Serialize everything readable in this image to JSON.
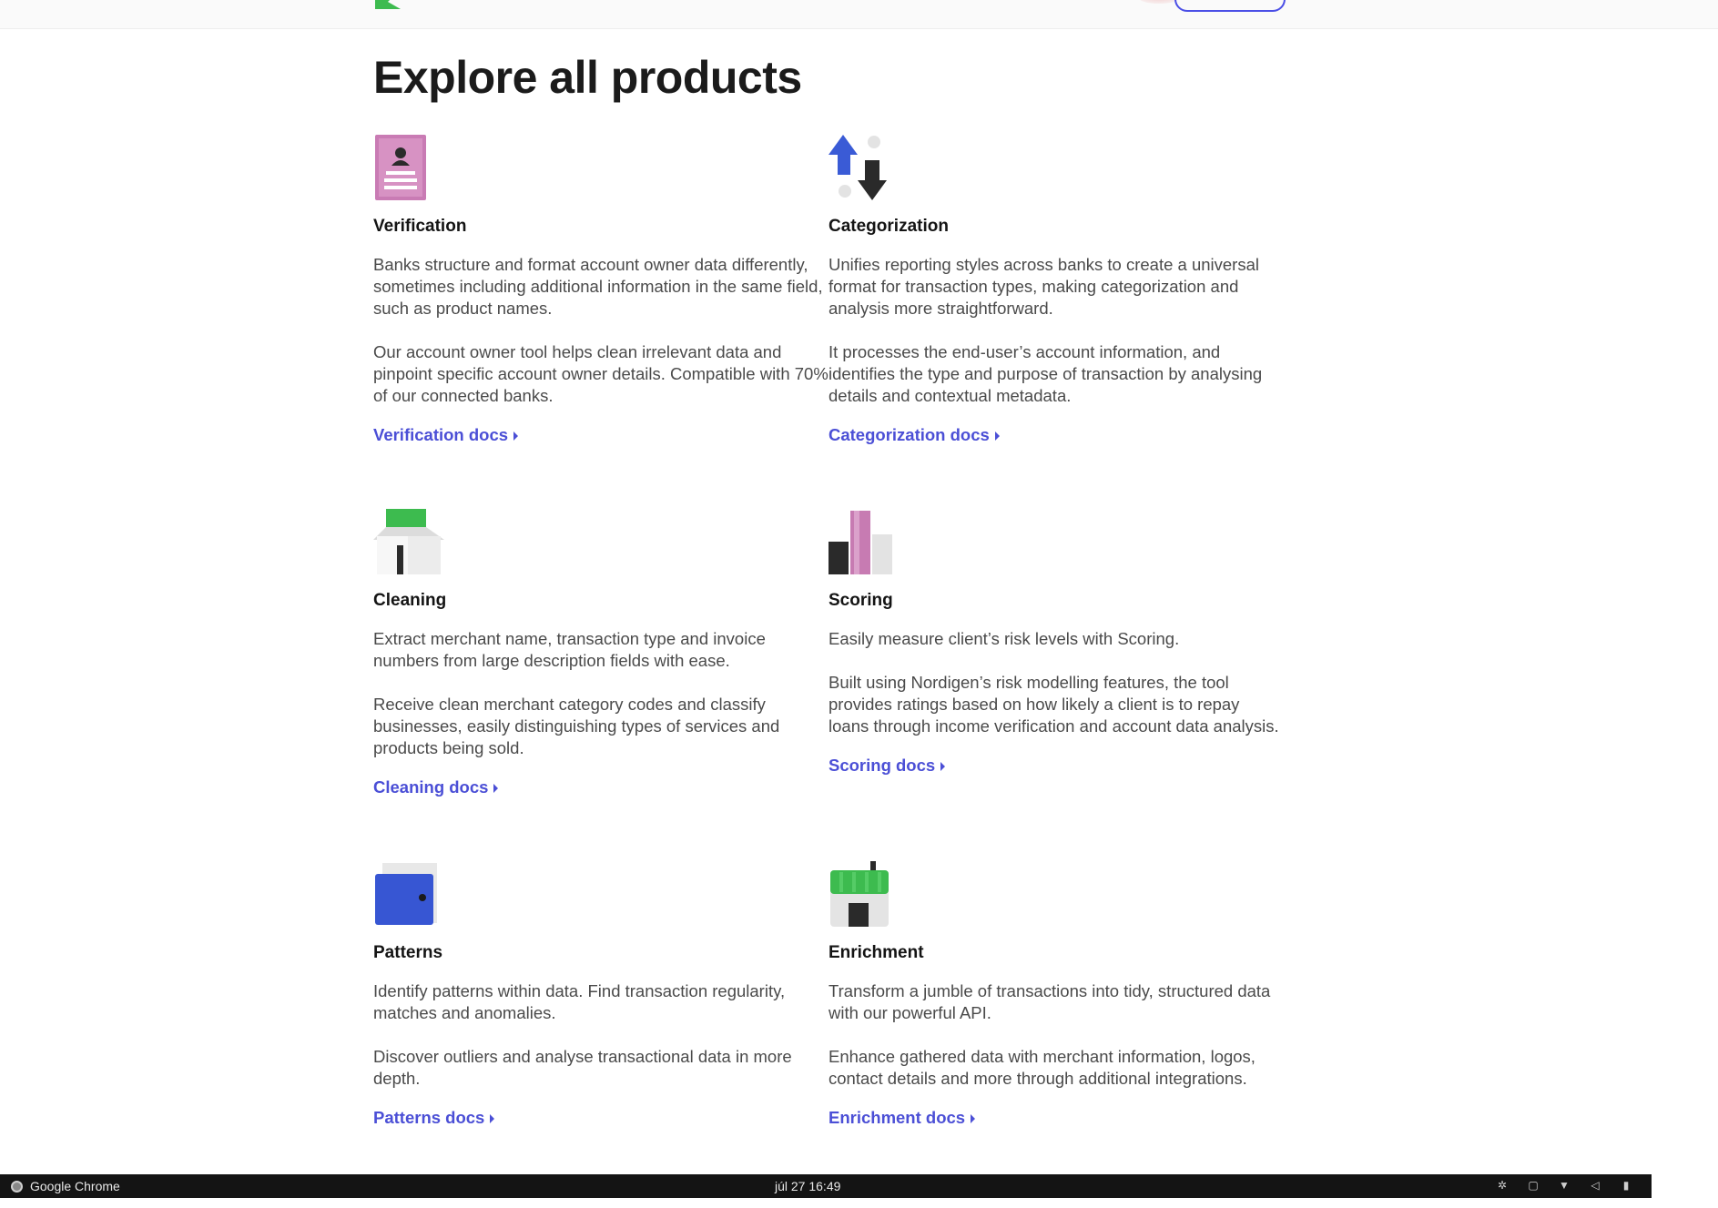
{
  "page": {
    "title": "Explore all products"
  },
  "products": [
    {
      "id": "verification",
      "icon": "id-card-icon",
      "title": "Verification",
      "paragraphs": [
        "Banks structure and format account owner data differently, sometimes including additional information in the same field, such as product names.",
        "Our account owner tool helps clean irrelevant data and pinpoint specific account owner details. Compatible with 70% of our connected banks."
      ],
      "link": "Verification docs"
    },
    {
      "id": "categorization",
      "icon": "up-down-arrows-icon",
      "title": "Categorization",
      "paragraphs": [
        "Unifies reporting styles across banks to create a universal format for transaction types, making categorization and analysis more straightforward.",
        "It processes the end-user’s account information, and identifies the type and purpose of transaction by analysing details and contextual metadata."
      ],
      "link": "Categorization docs"
    },
    {
      "id": "cleaning",
      "icon": "open-box-icon",
      "title": "Cleaning",
      "paragraphs": [
        "Extract merchant name, transaction type and invoice numbers from large description fields with ease.",
        "Receive clean merchant category codes and classify businesses, easily distinguishing types of services and products being sold."
      ],
      "link": "Cleaning docs"
    },
    {
      "id": "scoring",
      "icon": "bar-columns-icon",
      "title": "Scoring",
      "paragraphs": [
        "Easily measure client’s risk levels with Scoring.",
        "Built using Nordigen’s risk modelling features, the tool provides ratings based on how likely a client is to repay loans through income verification and account data analysis."
      ],
      "link": "Scoring docs"
    },
    {
      "id": "patterns",
      "icon": "wallet-icon",
      "title": "Patterns",
      "paragraphs": [
        "Identify patterns within data. Find transaction regularity, matches and anomalies.",
        "Discover outliers and analyse transactional data in more depth."
      ],
      "link": "Patterns docs"
    },
    {
      "id": "enrichment",
      "icon": "storefront-icon",
      "title": "Enrichment",
      "paragraphs": [
        "Transform a jumble of transactions into tidy, structured data with our powerful API.",
        "Enhance gathered data with merchant information, logos, contact details and more through additional integrations."
      ],
      "link": "Enrichment docs"
    }
  ],
  "taskbar": {
    "app": "Google Chrome",
    "clock": "júl 27  16:49"
  },
  "colors": {
    "link": "#4b4fd6",
    "brand_green": "#3dbb4f",
    "text": "#4a4a4a"
  }
}
